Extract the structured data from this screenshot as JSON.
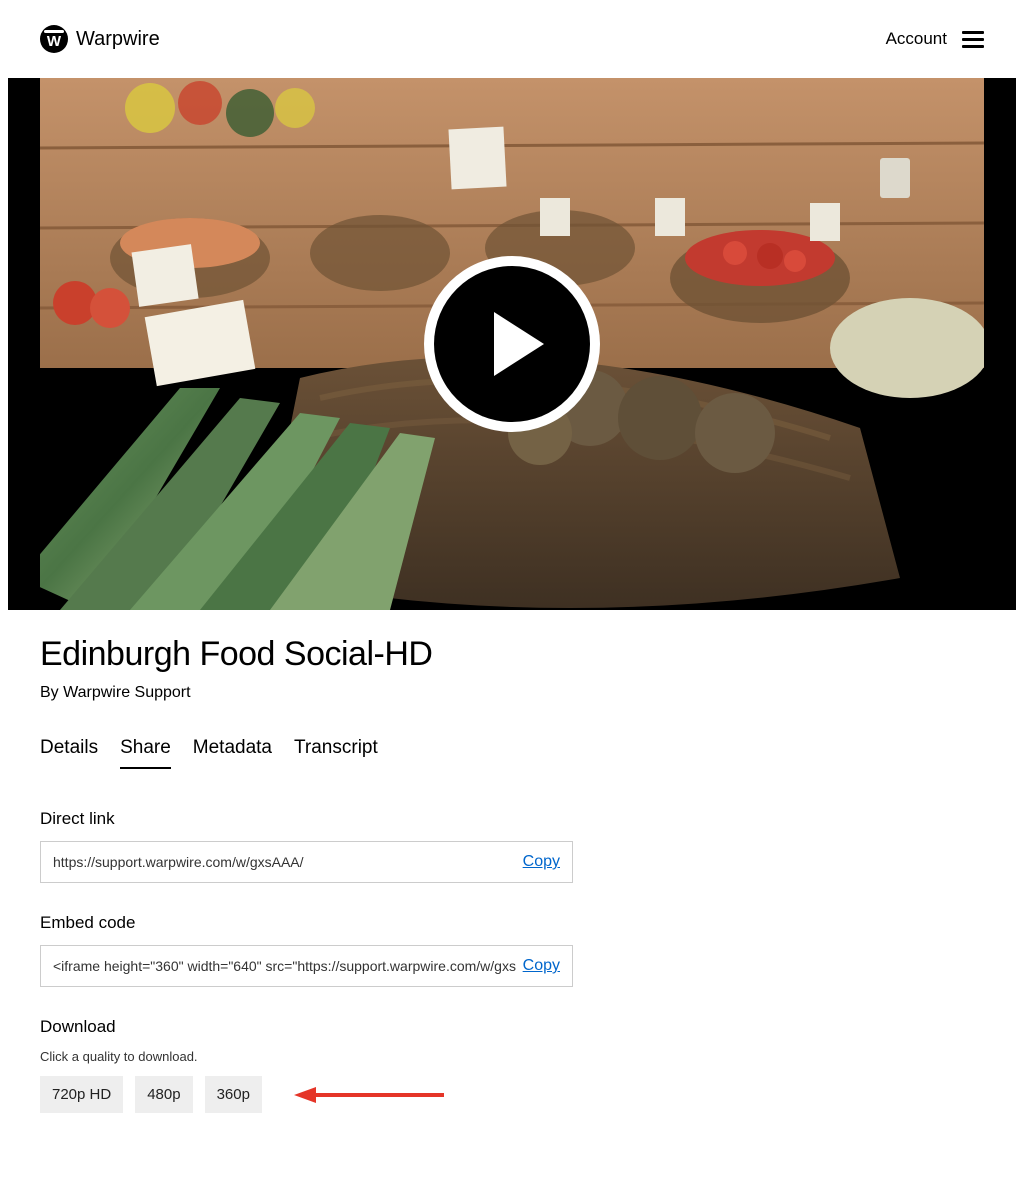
{
  "header": {
    "brand": "Warpwire",
    "brand_letter": "W",
    "account_label": "Account"
  },
  "video": {
    "title": "Edinburgh Food Social-HD",
    "byline": "By Warpwire Support"
  },
  "tabs": [
    {
      "label": "Details",
      "active": false
    },
    {
      "label": "Share",
      "active": true
    },
    {
      "label": "Metadata",
      "active": false
    },
    {
      "label": "Transcript",
      "active": false
    }
  ],
  "share": {
    "direct_link_label": "Direct link",
    "direct_link_value": "https://support.warpwire.com/w/gxsAAA/",
    "embed_label": "Embed code",
    "embed_value": "<iframe height=\"360\" width=\"640\" src=\"https://support.warpwire.com/w/gxs",
    "copy_label": "Copy",
    "download_label": "Download",
    "download_hint": "Click a quality to download.",
    "qualities": [
      "720p HD",
      "480p",
      "360p"
    ]
  }
}
